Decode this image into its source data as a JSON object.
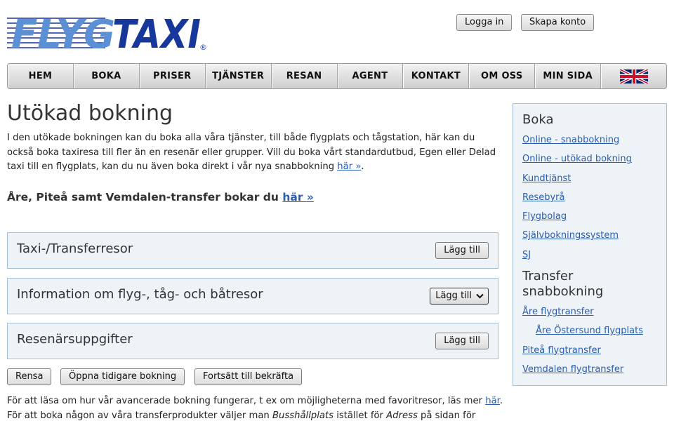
{
  "header": {
    "logo_text": "FLYGTAXI",
    "logo_mark": "®",
    "login_label": "Logga in",
    "signup_label": "Skapa konto",
    "colors": {
      "brand_light": "#5b8fd6",
      "brand_dark": "#17379a"
    }
  },
  "nav": {
    "items": [
      {
        "label": "HEM"
      },
      {
        "label": "BOKA"
      },
      {
        "label": "PRISER"
      },
      {
        "label": "TJÄNSTER"
      },
      {
        "label": "RESAN"
      },
      {
        "label": "AGENT"
      },
      {
        "label": "KONTAKT"
      },
      {
        "label": "OM OSS"
      },
      {
        "label": "MIN SIDA"
      }
    ],
    "flag_icon": "uk-flag-icon"
  },
  "main": {
    "title": "Utökad bokning",
    "intro_text": "I den utökade bokningen kan du boka alla våra tjänster, till både flygplats och tågstation, här kan du också boka taxiresa till fler än en resenär eller grupper. Vill du boka vårt standardutbud, Egen eller Delad taxi till en flygplats, kan du nu även boka direkt i vår nya snabbokning ",
    "intro_link": "här »",
    "intro_end": ".",
    "promo_text": "Åre, Piteå samt Vemdalen-transfer bokar du ",
    "promo_link": "här »",
    "panels": [
      {
        "title": "Taxi-/Transferresor",
        "button": "Lägg till"
      },
      {
        "title": "Information om flyg-, tåg- och båtresor",
        "select_value": "Lägg till"
      },
      {
        "title": "Resenärsuppgifter",
        "button": "Lägg till"
      }
    ],
    "actions": {
      "clear": "Rensa",
      "open_previous": "Öppna tidigare bokning",
      "continue": "Fortsätt till bekräfta"
    },
    "footnote_1": "För att läsa om hur vår avancerade bokning fungerar, t ex om möjligheterna med favoritresor, läs mer ",
    "footnote_1_link": "här",
    "footnote_1_end": ".",
    "footnote_2a": "För att boka någon av våra transferprodukter väljer man ",
    "footnote_2_em1": "Busshållplats",
    "footnote_2b": " istället för ",
    "footnote_2_em2": "Adress",
    "footnote_2c": " på sidan för"
  },
  "sidebar": {
    "heading_boka": "Boka",
    "boka_links": [
      "Online - snabbokning",
      "Online - utökad bokning",
      "Kundtjänst",
      "Resebyrå",
      "Flygbolag",
      "Självbokningssystem",
      "SJ"
    ],
    "heading_transfer": "Transfer snabbokning",
    "transfer_links": [
      {
        "label": "Åre flygtransfer",
        "sub": false
      },
      {
        "label": "Åre Östersund flygplats",
        "sub": true
      },
      {
        "label": "Piteå flygtransfer",
        "sub": false
      },
      {
        "label": "Vemdalen flygtransfer",
        "sub": false
      }
    ]
  }
}
